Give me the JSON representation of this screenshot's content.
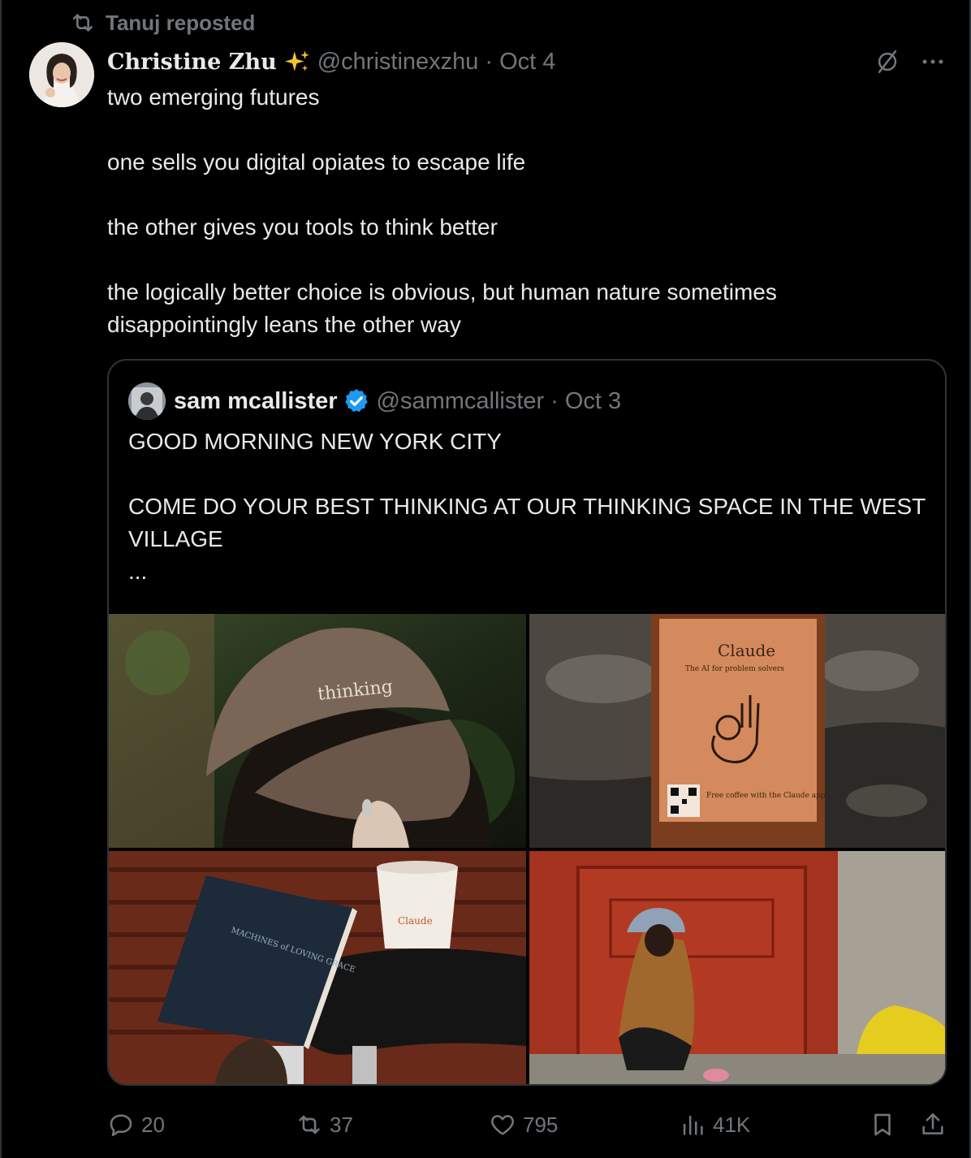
{
  "repost": {
    "label": "Tanuj reposted"
  },
  "tweet": {
    "author_name": "Christine Zhu",
    "handle": "@christinexzhu",
    "separator": "·",
    "date": "Oct 4",
    "text_lines": [
      "two emerging futures",
      "one sells you digital opiates to escape life",
      "the other gives you tools to think better",
      "the logically better choice is obvious, but human nature sometimes disappointingly leans the other way"
    ]
  },
  "quote": {
    "author_name": "sam mcallister",
    "handle": "@sammcallister",
    "separator": "·",
    "date": "Oct 3",
    "text_lines": [
      "GOOD MORNING NEW YORK CITY",
      "COME DO YOUR BEST THINKING AT OUR THINKING SPACE IN THE WEST VILLAGE",
      "..."
    ],
    "images": {
      "hat_text": "thinking",
      "sign_brand": "Claude",
      "sign_tagline": "The AI for problem solvers",
      "sign_offer": "Free coffee with the Claude app",
      "book_title": "MACHINES of LOVING GRACE",
      "cup_brand": "Claude"
    }
  },
  "actions": {
    "replies": "20",
    "reposts": "37",
    "likes": "795",
    "views": "41K"
  },
  "colors": {
    "background": "#000000",
    "text_primary": "#e7e9ea",
    "text_secondary": "#71767b",
    "border": "#2f3336",
    "verified": "#1d9bf0"
  }
}
